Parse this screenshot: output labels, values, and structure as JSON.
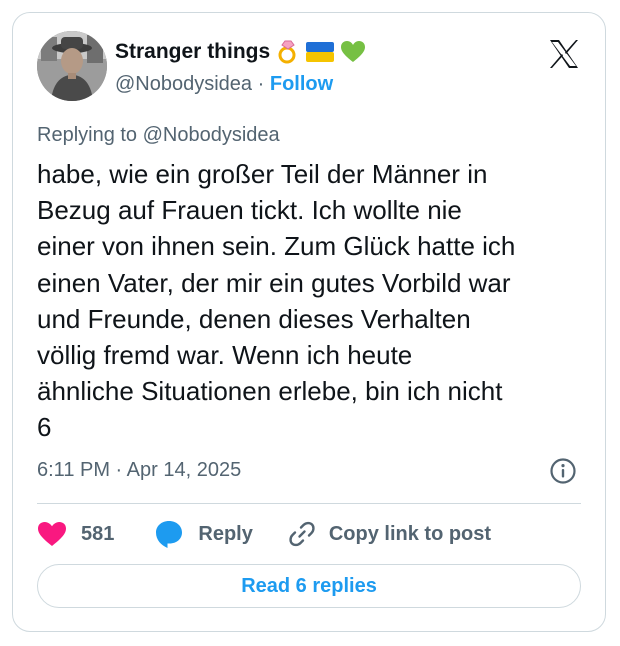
{
  "author": {
    "display_name": "Stranger things",
    "name_emojis": [
      "ring-emoji",
      "ukraine-flag-emoji",
      "green-heart-emoji"
    ],
    "handle": "@Nobodysidea",
    "separator": "·",
    "follow_label": "Follow",
    "avatar_icon": "profile-photo"
  },
  "platform_icon": "x-logo-icon",
  "reply_context": {
    "prefix": "Replying to",
    "mention": "@Nobodysidea"
  },
  "post": {
    "text": "habe, wie ein großer Teil der Männer in\nBezug auf Frauen tickt. Ich wollte nie\neiner von ihnen sein. Zum Glück hatte ich\neinen Vater, der mir ein gutes Vorbild war\nund Freunde, denen dieses Verhalten\nvöllig fremd war. Wenn ich heute\nähnliche Situationen erlebe, bin ich nicht\n6",
    "timestamp": "6:11 PM · Apr 14, 2025",
    "info_icon": "info-icon"
  },
  "actions": {
    "like_count": "581",
    "reply_label": "Reply",
    "copy_label": "Copy link to post"
  },
  "read_replies_label": "Read 6 replies",
  "colors": {
    "accent": "#1d9bf0",
    "like": "#f91880",
    "secondary_text": "#536471",
    "border": "#cfd9de",
    "text": "#0f1419"
  }
}
